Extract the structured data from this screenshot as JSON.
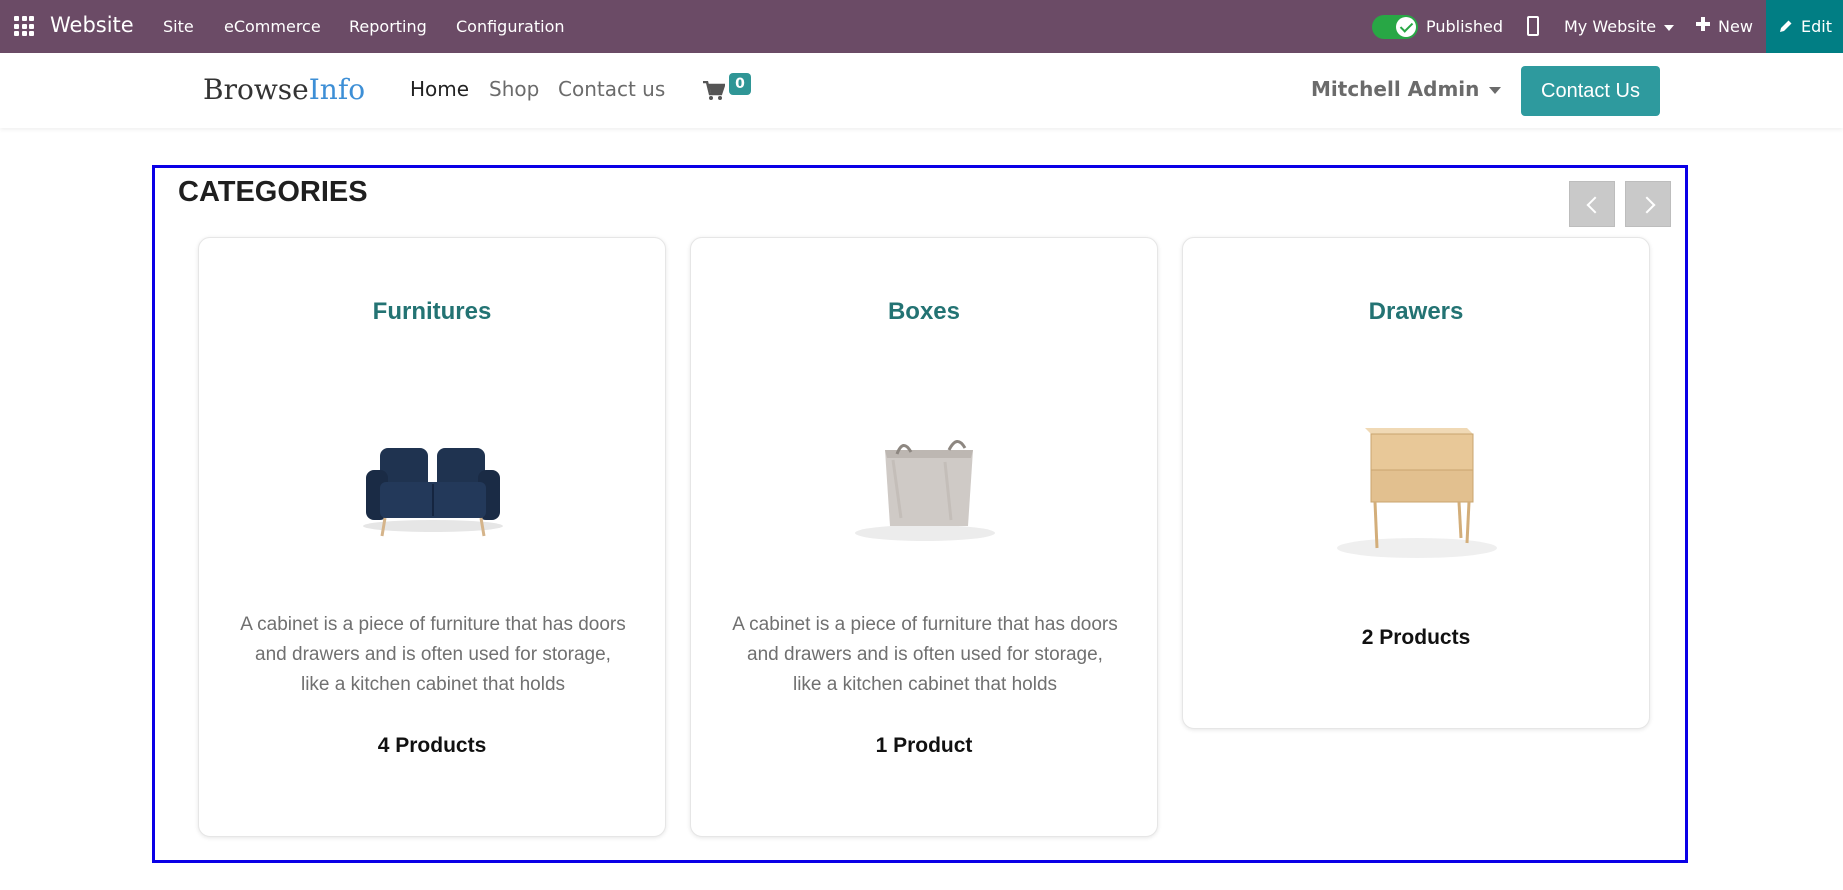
{
  "admin_bar": {
    "app_name": "Website",
    "menus": [
      "Site",
      "eCommerce",
      "Reporting",
      "Configuration"
    ],
    "published_label": "Published",
    "website_selector": "My Website",
    "new_label": "New",
    "edit_label": "Edit"
  },
  "site_header": {
    "logo_part1": "Browse",
    "logo_part2": "Info",
    "nav": [
      "Home",
      "Shop",
      "Contact us"
    ],
    "cart_count": "0",
    "user_name": "Mitchell Admin",
    "contact_button": "Contact Us"
  },
  "categories": {
    "title": "CATEGORIES",
    "items": [
      {
        "name": "Furnitures",
        "description": "A cabinet is a piece of furniture that has doors and drawers and is often used for storage, like a kitchen cabinet that holds",
        "count": "4 Products"
      },
      {
        "name": "Boxes",
        "description": "A cabinet is a piece of furniture that has doors and drawers and is often used for storage, like a kitchen cabinet that holds",
        "count": "1 Product"
      },
      {
        "name": "Drawers",
        "description": "",
        "count": "2 Products"
      }
    ]
  },
  "colors": {
    "admin_bar": "#6b4b66",
    "edit_button": "#017e84",
    "accent_teal": "#2e9a9e",
    "category_title": "#237373",
    "selection_border": "#0a00e6"
  }
}
